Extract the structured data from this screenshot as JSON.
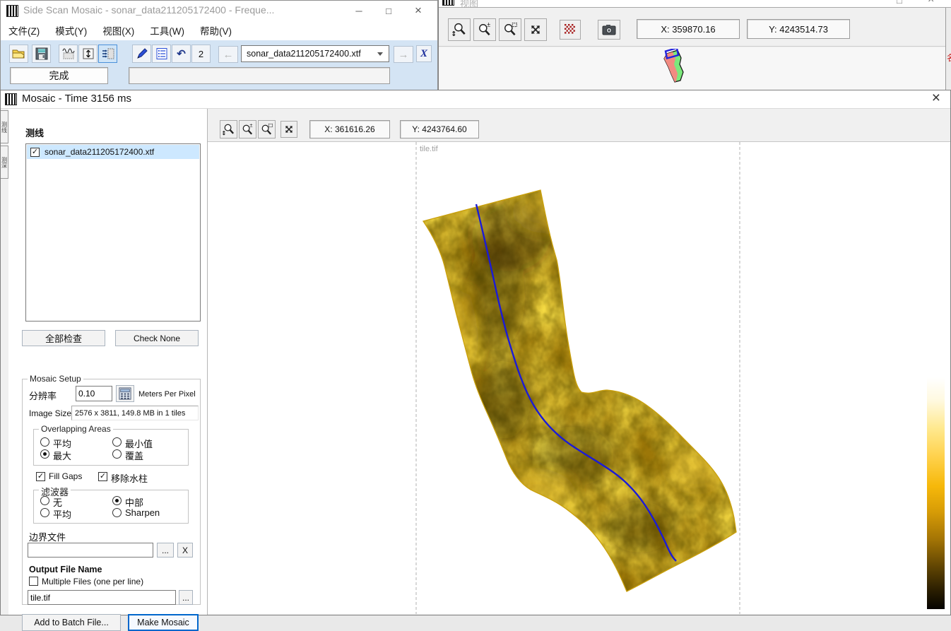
{
  "icons": {
    "minimize": "─",
    "maximize": "□",
    "close": "×",
    "undo": "↶",
    "back": "←",
    "forward": "→",
    "clear_x": "X",
    "check": "✓"
  },
  "main_window": {
    "title": "Side Scan Mosaic - sonar_data211205172400 - Freque...",
    "menu": [
      "文件(Z)",
      "模式(Y)",
      "视图(X)",
      "工具(W)",
      "帮助(V)"
    ],
    "toolbar": {
      "count_value": "2",
      "file_selector": "sonar_data211205172400.xtf"
    },
    "status": {
      "done_label": "完成"
    }
  },
  "nav_window": {
    "title": "视图",
    "toolbar": {
      "x_coord": "X: 359870.16",
      "y_coord": "Y: 4243514.73"
    }
  },
  "right_edge": {
    "fragment": "名"
  },
  "mosaic_window": {
    "title": "Mosaic - Time 3156 ms",
    "side_tabs": [
      "测线",
      "测深"
    ],
    "panel": {
      "lines_label": "测线",
      "line_item": "sonar_data211205172400.xtf",
      "check_all": "全部检查",
      "check_none": "Check None",
      "setup": {
        "legend": "Mosaic Setup",
        "resolution_label": "分辨率",
        "resolution_value": "0.10",
        "resolution_unit": "Meters Per Pixel",
        "image_size_label": "Image Size",
        "image_size_value": "2576 x 3811, 149.8 MB in 1 tiles",
        "overlap": {
          "legend": "Overlapping Areas",
          "options": [
            "平均",
            "最大",
            "最小值",
            "覆盖"
          ],
          "selected": "最大"
        },
        "fill_gaps_label": "Fill Gaps",
        "remove_water_label": "移除水柱",
        "filter": {
          "legend": "滤波器",
          "options": [
            "无",
            "平均",
            "中部",
            "Sharpen"
          ],
          "selected": "中部"
        },
        "boundary_label": "边界文件",
        "boundary_value": "",
        "browse_label": "...",
        "clear_label": "X",
        "output_legend": "Output File Name",
        "multiple_files_label": "Multiple Files (one per line)",
        "output_value": "tile.tif"
      },
      "add_batch": "Add to Batch File...",
      "make_mosaic": "Make Mosaic"
    },
    "map": {
      "x_coord": "X: 361616.26",
      "y_coord": "Y: 4243764.60",
      "tile_label": "tile.tif"
    }
  },
  "colors": {
    "accent_blue": "#0066cc",
    "track_line": "#1b1bd6",
    "mosaic_gold": "#c89a08"
  }
}
